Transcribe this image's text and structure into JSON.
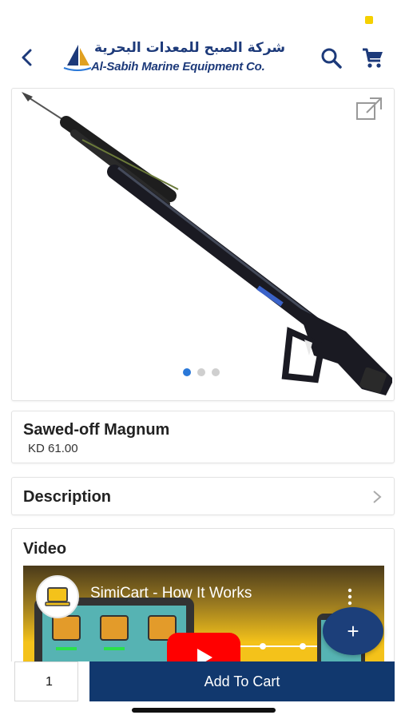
{
  "header": {
    "logo_arabic": "شركة الصبح للمعدات البحرية",
    "logo_english": "Al-Sabih Marine Equipment Co."
  },
  "product": {
    "name": "Sawed-off Magnum",
    "price": "KD 61.00",
    "image_count": 3,
    "active_image_index": 0
  },
  "sections": {
    "description_label": "Description",
    "video_label": "Video"
  },
  "video": {
    "title": "SimiCart - How It Works"
  },
  "cart": {
    "quantity": "1",
    "add_label": "Add To Cart"
  },
  "fab": {
    "label": "+"
  },
  "colors": {
    "primary": "#11386e",
    "accent_dot": "#2a78d8",
    "status_indicator": "#f5d000"
  }
}
